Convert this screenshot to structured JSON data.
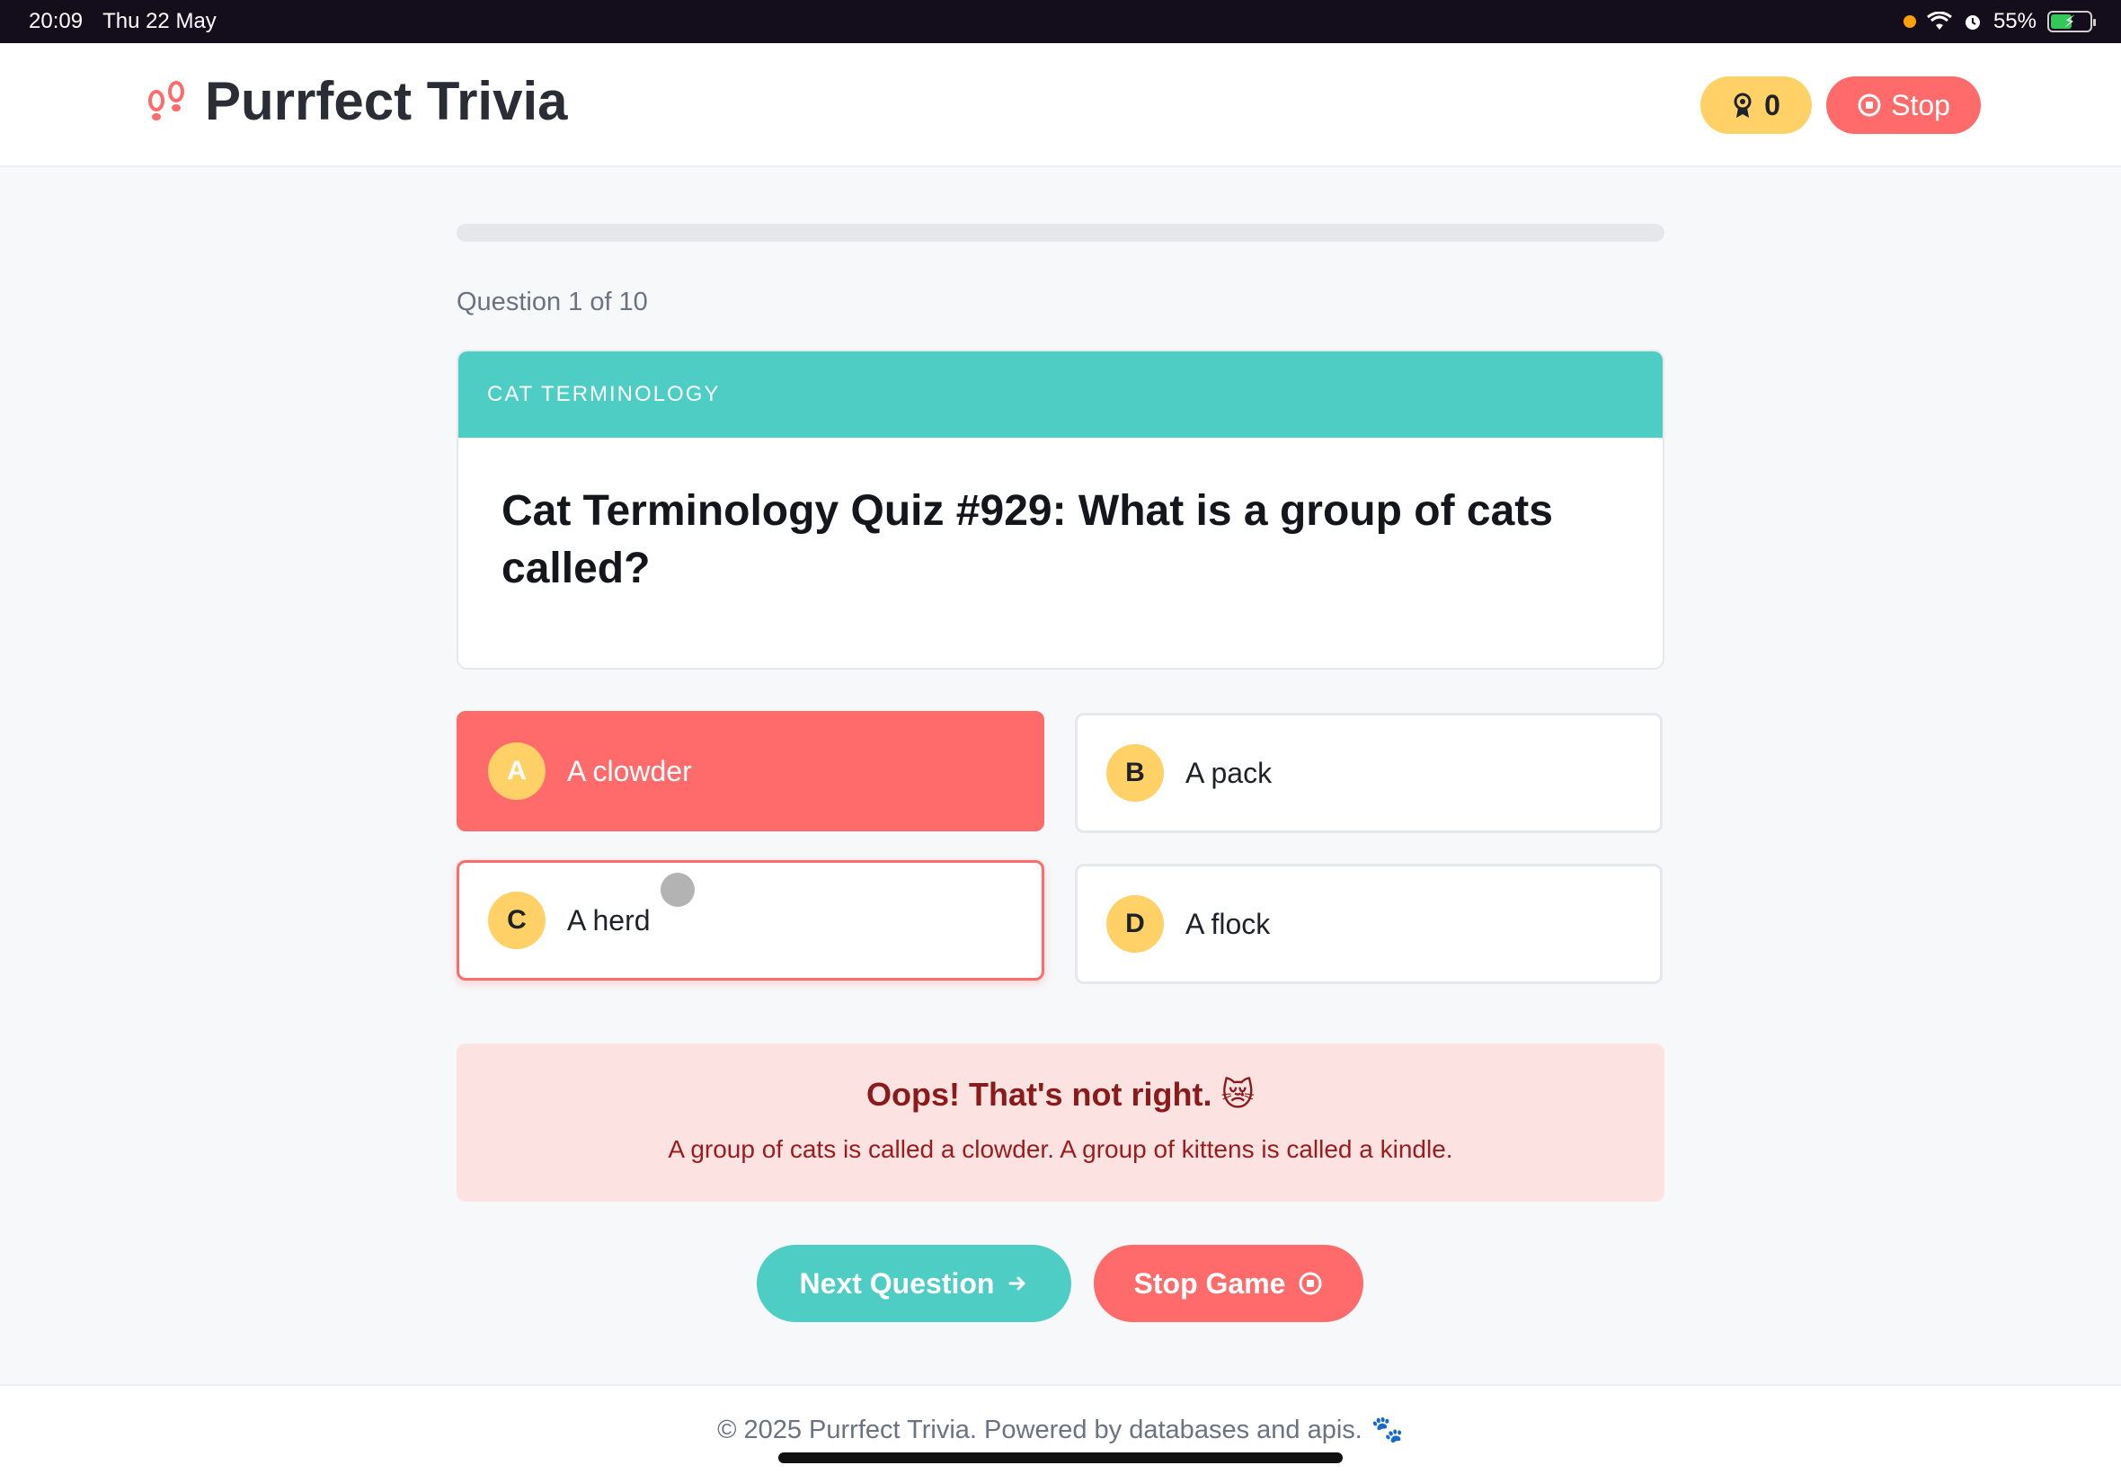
{
  "status_bar": {
    "time": "20:09",
    "date": "Thu 22 May",
    "battery": "55%",
    "battery_level": 0.55
  },
  "header": {
    "title": "Purrfect Trivia",
    "score": "0",
    "stop_label": "Stop"
  },
  "progress": {
    "fraction": 0.0,
    "label": "Question 1 of 10"
  },
  "question": {
    "category": "CAT TERMINOLOGY",
    "text": "Cat Terminology Quiz #929: What is a group of cats called?"
  },
  "answers": [
    {
      "letter": "A",
      "text": "A clowder",
      "state": "correct"
    },
    {
      "letter": "B",
      "text": "A pack",
      "state": "neutral"
    },
    {
      "letter": "C",
      "text": "A herd",
      "state": "selected-wrong"
    },
    {
      "letter": "D",
      "text": "A flock",
      "state": "neutral"
    }
  ],
  "feedback": {
    "title": "Oops! That's not right. 😿",
    "body": "A group of cats is called a clowder. A group of kittens is called a kindle."
  },
  "actions": {
    "next_label": "Next Question",
    "stop_label": "Stop Game"
  },
  "footer": {
    "text": "© 2025 Purrfect Trivia. Powered by databases and apis.",
    "emoji": "🐾"
  },
  "colors": {
    "accent_teal": "#4ecdc4",
    "accent_red": "#ff6b6b",
    "accent_yellow": "#ffd166"
  }
}
